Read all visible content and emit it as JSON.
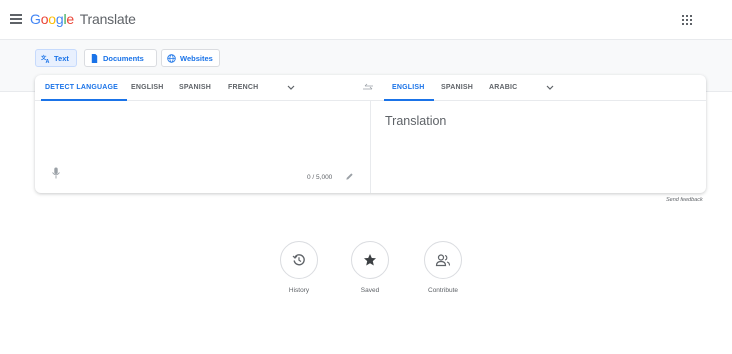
{
  "header": {
    "logo_letters": [
      "G",
      "o",
      "o",
      "g",
      "l",
      "e"
    ],
    "product_name": "Translate",
    "menu_icon": "hamburger-menu-icon",
    "apps_icon": "apps-grid-icon"
  },
  "modes": [
    {
      "label": "Text",
      "icon": "translate-icon",
      "active": true
    },
    {
      "label": "Documents",
      "icon": "document-icon",
      "active": false
    },
    {
      "label": "Websites",
      "icon": "globe-icon",
      "active": false
    }
  ],
  "source_languages": [
    "DETECT LANGUAGE",
    "ENGLISH",
    "SPANISH",
    "FRENCH"
  ],
  "target_languages": [
    "ENGLISH",
    "SPANISH",
    "ARABIC"
  ],
  "source": {
    "char_count": "0 / 5,000"
  },
  "target": {
    "placeholder": "Translation"
  },
  "feedback_label": "Send feedback",
  "actions": [
    {
      "label": "History",
      "icon": "history-icon"
    },
    {
      "label": "Saved",
      "icon": "star-icon"
    },
    {
      "label": "Contribute",
      "icon": "contribute-people-icon"
    }
  ],
  "colors": {
    "accent": "#1a73e8",
    "text": "#3c4043",
    "muted": "#5f6368",
    "band_background": "#f8f9fa"
  }
}
